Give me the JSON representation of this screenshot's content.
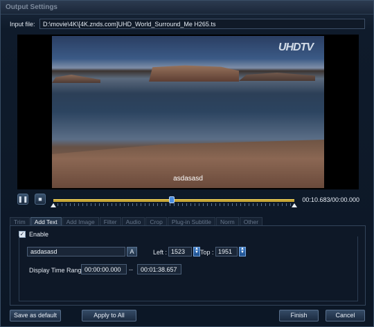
{
  "window": {
    "title": "Output Settings"
  },
  "input": {
    "label": "Input file:",
    "value": "D:\\movie\\4K\\[4K.znds.com]UHD_World_Surround_Me H265.ts"
  },
  "preview": {
    "watermark": "UHDTV",
    "overlay_text": "asdasasd"
  },
  "player": {
    "pause_icon": "pause-icon",
    "stop_icon": "stop-icon",
    "progress_fraction": 0.49,
    "time": "00:10.683/00:00.000"
  },
  "tabs": [
    {
      "label": "Trim",
      "active": false
    },
    {
      "label": "Add Text",
      "active": true
    },
    {
      "label": "Add Image",
      "active": false
    },
    {
      "label": "Filter",
      "active": false
    },
    {
      "label": "Audio",
      "active": false
    },
    {
      "label": "Crop",
      "active": false
    },
    {
      "label": "Plug-in Subtitle",
      "active": false
    },
    {
      "label": "Norm",
      "active": false
    },
    {
      "label": "Other",
      "active": false
    }
  ],
  "text_panel": {
    "enable_label": "Enable",
    "enable_checked": true,
    "text_value": "asdasasd",
    "font_button": "A",
    "left_label": "Left :",
    "left_value": "1523",
    "top_label": "Top :",
    "top_value": "1951",
    "range_label": "Display Time Range:",
    "range_start": "00:00:00.000",
    "range_separator": "--",
    "range_end": "00:01:38.657"
  },
  "buttons": {
    "save_default": "Save as default",
    "apply_all": "Apply to All",
    "finish": "Finish",
    "cancel": "Cancel"
  },
  "colors": {
    "accent": "#4b8ee0",
    "progress_track": "#c7a636",
    "background": "#0d1a2b"
  }
}
